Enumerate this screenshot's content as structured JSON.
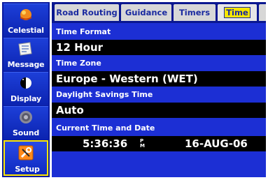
{
  "sidebar": {
    "items": [
      {
        "label": "Celestial",
        "icon": "celestial-icon"
      },
      {
        "label": "Message",
        "icon": "message-icon"
      },
      {
        "label": "Display",
        "icon": "display-icon"
      },
      {
        "label": "Sound",
        "icon": "sound-icon"
      },
      {
        "label": "Setup",
        "icon": "setup-icon",
        "active": true
      }
    ]
  },
  "tabs": [
    {
      "label": "Road Routing"
    },
    {
      "label": "Guidance"
    },
    {
      "label": "Timers"
    },
    {
      "label": "Time",
      "active": true
    },
    {
      "label": ""
    }
  ],
  "fields": {
    "time_format": {
      "label": "Time Format",
      "value": "12 Hour"
    },
    "time_zone": {
      "label": "Time Zone",
      "value": "Europe - Western (WET)"
    },
    "daylight_savings": {
      "label": "Daylight Savings Time",
      "value": "Auto"
    },
    "current_time": {
      "label": "Current Time and Date",
      "time": "5:36:36",
      "ampm_top": "P",
      "ampm_bottom": "M",
      "date": "16-AUG-06"
    }
  },
  "colors": {
    "panel": "#1c2fd4",
    "sidebar": "#0a1a9e",
    "highlight": "#f6e600",
    "field_bg": "#000000"
  }
}
